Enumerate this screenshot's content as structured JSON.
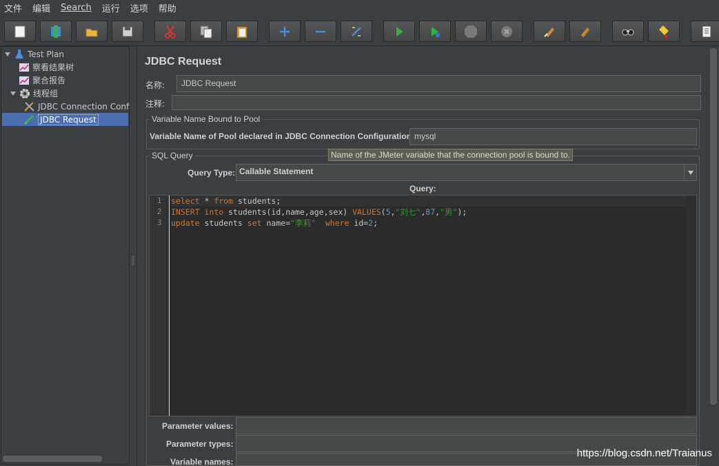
{
  "menu": [
    "文件",
    "编辑",
    "Search",
    "运行",
    "选项",
    "帮助"
  ],
  "toolbar": [
    {
      "name": "new-icon"
    },
    {
      "name": "templates-icon"
    },
    {
      "name": "open-icon"
    },
    {
      "name": "save-icon"
    },
    {
      "name": "cut-icon"
    },
    {
      "name": "copy-icon"
    },
    {
      "name": "paste-icon"
    },
    {
      "name": "expand-icon"
    },
    {
      "name": "collapse-icon"
    },
    {
      "name": "toggle-icon"
    },
    {
      "name": "start-icon"
    },
    {
      "name": "start-no-pause-icon"
    },
    {
      "name": "stop-icon"
    },
    {
      "name": "shutdown-icon"
    },
    {
      "name": "clear-icon"
    },
    {
      "name": "clear-all-icon"
    },
    {
      "name": "search-icon"
    },
    {
      "name": "reset-search-icon"
    },
    {
      "name": "function-helper-icon"
    }
  ],
  "tree": {
    "items": [
      {
        "label": "Test Plan",
        "icon": "flask-icon"
      },
      {
        "label": "察看结果树",
        "icon": "chart-icon"
      },
      {
        "label": "聚合报告",
        "icon": "chart-icon"
      },
      {
        "label": "线程组",
        "icon": "gear-icon"
      },
      {
        "label": "JDBC Connection Confi",
        "icon": "wrench-icon"
      },
      {
        "label": "JDBC Request",
        "icon": "pen-icon"
      }
    ]
  },
  "panel": {
    "title": "JDBC Request",
    "name_label": "名称:",
    "name_value": "JDBC Request",
    "comment_label": "注释:",
    "comment_value": "",
    "pool_group_title": "Variable Name Bound to Pool",
    "pool_label": "Variable Name of Pool declared in JDBC Connection Configuration:",
    "pool_value": "mysql",
    "tooltip": "Name of the JMeter variable that the connection pool is bound to.",
    "sql_group_title": "SQL Query",
    "query_type_label": "Query Type:",
    "query_type_value": "Callable Statement",
    "query_label": "Query:",
    "param_values_label": "Parameter values:",
    "param_types_label": "Parameter types:",
    "variable_names_label": "Variable names:"
  },
  "sql": {
    "line_numbers": [
      "1",
      "2",
      "3"
    ],
    "line1": {
      "kw1": "select",
      "t1": " * ",
      "kw2": "from",
      "t2": " students;"
    },
    "line2": {
      "kw1": "INSERT",
      "t1": " ",
      "kw2": "into",
      "t2": " students(id,name,age,sex) ",
      "kw3": "VALUES",
      "t3": "(",
      "n1": "5",
      "t4": ",",
      "s1": "\"刘七\"",
      "t5": ",",
      "n2": "87",
      "t6": ",",
      "s2": "\"男\"",
      "t7": ");"
    },
    "line3": {
      "kw1": "update",
      "t1": " students ",
      "kw2": "set",
      "t2": " name=",
      "s1": "\"李莉\"",
      "t3": "  ",
      "kw3": "where",
      "t4": " id=",
      "n1": "2",
      "t5": ";"
    }
  },
  "watermark": "https://blog.csdn.net/Traianus"
}
